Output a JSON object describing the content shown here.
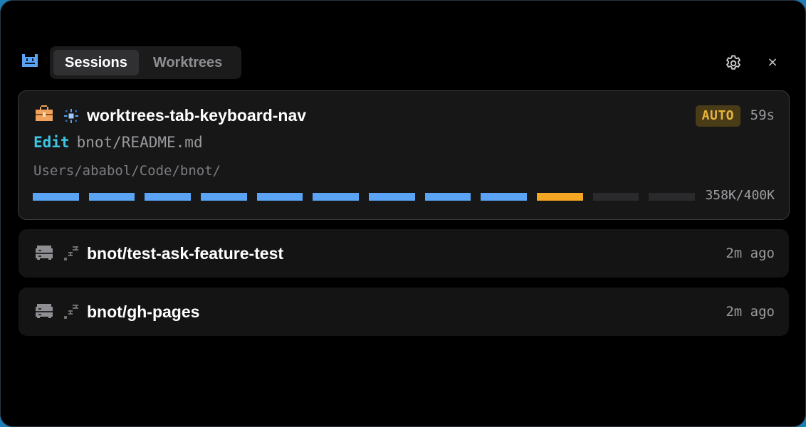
{
  "tabs": [
    {
      "label": "Sessions",
      "active": true
    },
    {
      "label": "Worktrees",
      "active": false
    }
  ],
  "icons": {
    "app_logo": "pixel-robot-icon",
    "settings": "gear-icon",
    "close": "close-icon"
  },
  "close_label": "×",
  "sessions": [
    {
      "title": "worktrees-tab-keyboard-nav",
      "row_icon": "pixel-toolbox-icon",
      "state_icon": "pixel-sparkle-icon",
      "badge": "AUTO",
      "time": "59s",
      "action": {
        "verb": "Edit",
        "path": "bnot/README.md"
      },
      "cwd": "Users/ababol/Code/bnot/",
      "context": {
        "used_label": "358K/400K",
        "used": 358,
        "limit": 400,
        "segments": 12,
        "filled_segments": 9,
        "warn_segments": 1
      }
    },
    {
      "title": "bnot/test-ask-feature-test",
      "row_icon": "pixel-server-icon",
      "state_icon": "sleep-zzz-icon",
      "time": "2m ago"
    },
    {
      "title": "bnot/gh-pages",
      "row_icon": "pixel-server-icon",
      "state_icon": "sleep-zzz-icon",
      "time": "2m ago"
    }
  ],
  "colors": {
    "accent_blue": "#5ba3f5",
    "warning_orange": "#f5a623",
    "edit_cyan": "#3dc6e6",
    "badge_text": "#e6b43c",
    "badge_bg": "#4a3c17",
    "empty_segment": "#2a2a2c"
  }
}
